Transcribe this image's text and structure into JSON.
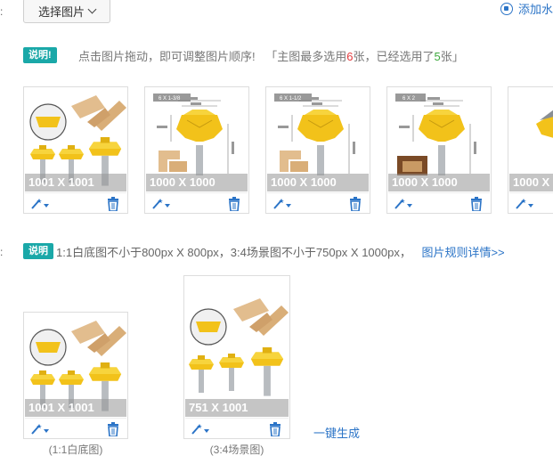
{
  "row1": {
    "colon": ":",
    "select_button": "选择图片",
    "add_watermark": "添加水"
  },
  "tip1": {
    "badge": "说明!",
    "text_a": "点击图片拖动，即可调整图片顺序!",
    "text_b": "「主图最多选用",
    "max_count": "6",
    "text_c": "张，已经选用了",
    "used_count": "5",
    "text_d": "张」"
  },
  "main_images": [
    {
      "caption": "1001 X 1001",
      "kind": "composite"
    },
    {
      "caption": "1000 X 1000",
      "kind": "spec",
      "label": "6 X 1-3/8"
    },
    {
      "caption": "1000 X 1000",
      "kind": "spec",
      "label": "6 X 1-1/2"
    },
    {
      "caption": "1000 X 1000",
      "kind": "spec-box",
      "label": "6 X 2"
    },
    {
      "caption": "1000 X"
    }
  ],
  "tip2": {
    "colon": ":",
    "badge": "说明",
    "text": "1:1白底图不小于800px X 800px，3:4场景图不小于750px X 1000px，",
    "link": "图片规则详情>>"
  },
  "extra_images": [
    {
      "caption": "1001 X 1001",
      "label": "(1:1白底图)"
    },
    {
      "caption": "751 X 1001",
      "label": "(3:4场景图)"
    }
  ],
  "generate_link": "一键生成",
  "colors": {
    "accent": "#2b74c7",
    "badge": "#1aa8a8",
    "red": "#e4393c",
    "green": "#3da93d",
    "cutter": "#f2c21a"
  }
}
